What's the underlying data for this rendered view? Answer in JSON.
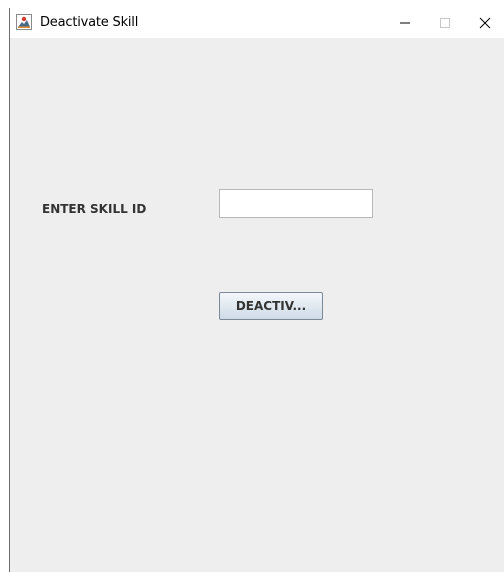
{
  "window": {
    "title": "Deactivate Skill",
    "controls": {
      "minimize_icon": "minimize-icon",
      "maximize_icon": "maximize-icon",
      "close_icon": "close-icon"
    }
  },
  "form": {
    "skill_id_label": "ENTER SKILL ID",
    "skill_id_value": "",
    "deactivate_button_label": "DEACTIV..."
  },
  "colors": {
    "window_background": "#eeeeee",
    "titlebar_background": "#ffffff",
    "button_border": "#7a8a99",
    "label_text": "#333333"
  }
}
